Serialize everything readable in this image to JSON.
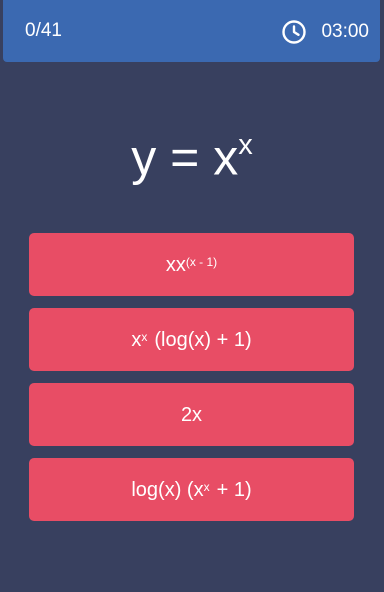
{
  "header": {
    "progress": "0/41",
    "timer": "03:00",
    "timer_icon": "clock-icon"
  },
  "question": {
    "base": "y = x",
    "exponent": "x"
  },
  "answers": [
    {
      "base": "xx",
      "exponent": "(x - 1)",
      "tail": ""
    },
    {
      "base": "x",
      "exponent": "x",
      "tail": "(log(x) + 1)"
    },
    {
      "base": "2x",
      "exponent": "",
      "tail": ""
    },
    {
      "base": "log(x) (x",
      "exponent": "x",
      "tail": "+ 1)"
    }
  ],
  "colors": {
    "background": "#38405f",
    "header": "#3b69b1",
    "answer": "#e84d65",
    "text": "#ffffff"
  }
}
